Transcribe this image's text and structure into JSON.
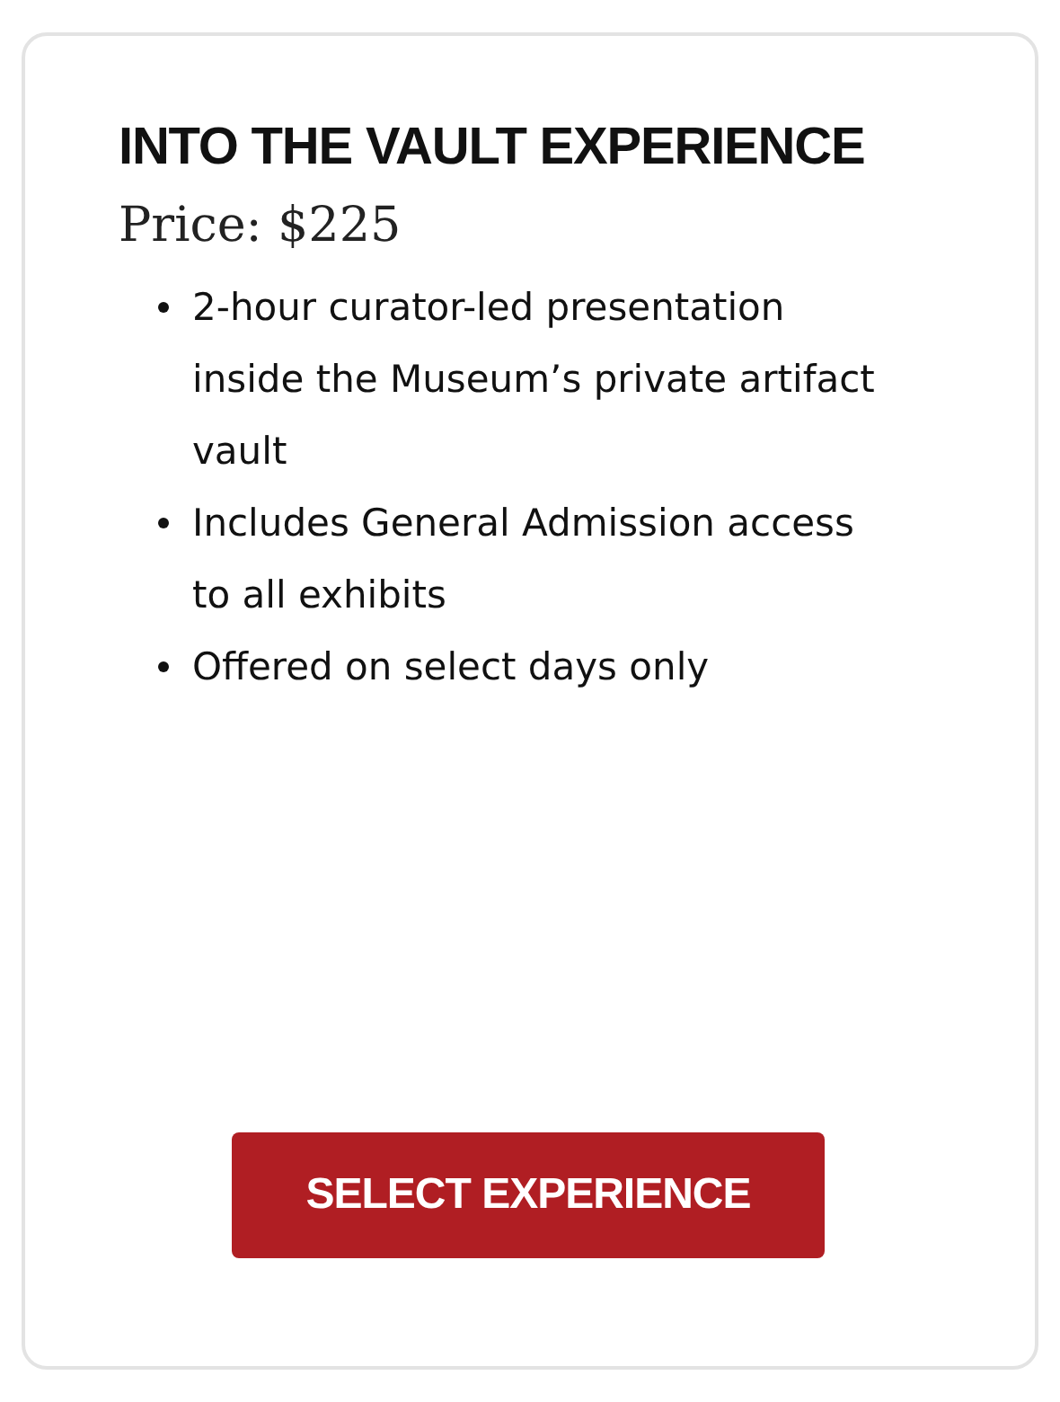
{
  "card": {
    "title": "INTO THE VAULT EXPERIENCE",
    "price": "Price: $225",
    "features": [
      "2-hour curator-led presentation inside the Museum’s private artifact vault",
      "Includes General Admission access to all exhibits",
      "Offered on select days only"
    ],
    "button": "SELECT EXPERIENCE"
  }
}
